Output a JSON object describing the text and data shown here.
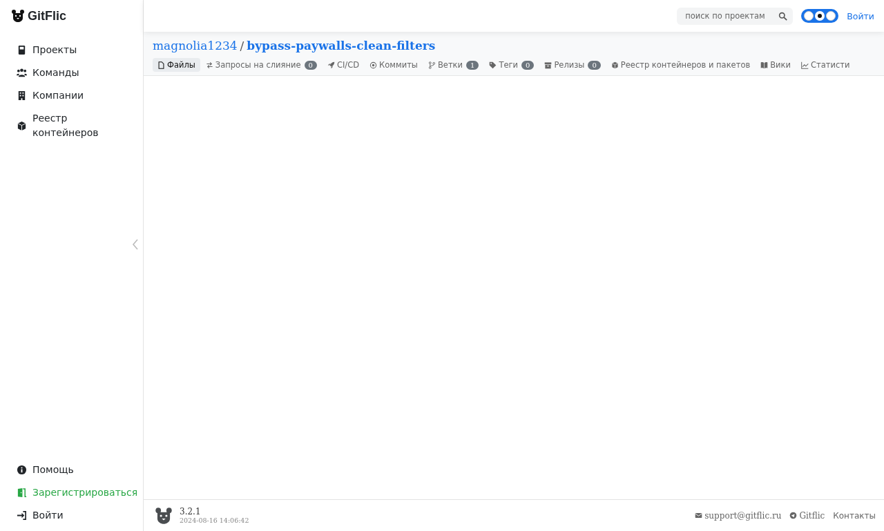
{
  "brand": "GitFlic",
  "search": {
    "placeholder": "поиск по проектам"
  },
  "theme_switch": [
    {
      "selected": false
    },
    {
      "selected": true
    },
    {
      "selected": false
    }
  ],
  "login_link": "Войти",
  "sidebar": {
    "items": [
      {
        "label": "Проекты",
        "kind": "book",
        "accent": false
      },
      {
        "label": "Команды",
        "kind": "users",
        "accent": false
      },
      {
        "label": "Компании",
        "kind": "building",
        "accent": false
      },
      {
        "label": "Реестр контейнеров",
        "kind": "box",
        "accent": false
      }
    ],
    "bottom_items": [
      {
        "label": "Помощь",
        "kind": "info",
        "accent": false
      },
      {
        "label": "Зарегистрироваться",
        "kind": "door",
        "accent": true
      },
      {
        "label": "Войти",
        "kind": "login",
        "accent": false
      }
    ]
  },
  "breadcrumb": {
    "owner": "magnolia1234",
    "separator": "/",
    "repo": "bypass-paywalls-clean-filters"
  },
  "tabs": [
    {
      "label": "Файлы",
      "kind": "file",
      "selected": true
    },
    {
      "label": "Запросы на слияние",
      "kind": "arrows",
      "selected": false,
      "count": "0"
    },
    {
      "label": "CI/CD",
      "kind": "rocket",
      "selected": false
    },
    {
      "label": "Коммиты",
      "kind": "commit",
      "selected": false
    },
    {
      "label": "Ветки",
      "kind": "branch",
      "selected": false,
      "count": "1"
    },
    {
      "label": "Теги",
      "kind": "tag",
      "selected": false,
      "count": "0"
    },
    {
      "label": "Релизы",
      "kind": "archive",
      "selected": false,
      "count": "0"
    },
    {
      "label": "Реестр контейнеров и пакетов",
      "kind": "box",
      "selected": false
    },
    {
      "label": "Вики",
      "kind": "bookopen",
      "selected": false
    },
    {
      "label": "Статисти",
      "kind": "chart",
      "selected": false
    }
  ],
  "footer": {
    "version": "3.2.1",
    "build_date": "2024-08-16 14:06:42",
    "links": [
      {
        "label": "support@gitflic.ru",
        "kind": "mail"
      },
      {
        "label": "Gitflic",
        "kind": "telegram"
      },
      {
        "label": "Контакты",
        "kind": "plain"
      }
    ]
  }
}
